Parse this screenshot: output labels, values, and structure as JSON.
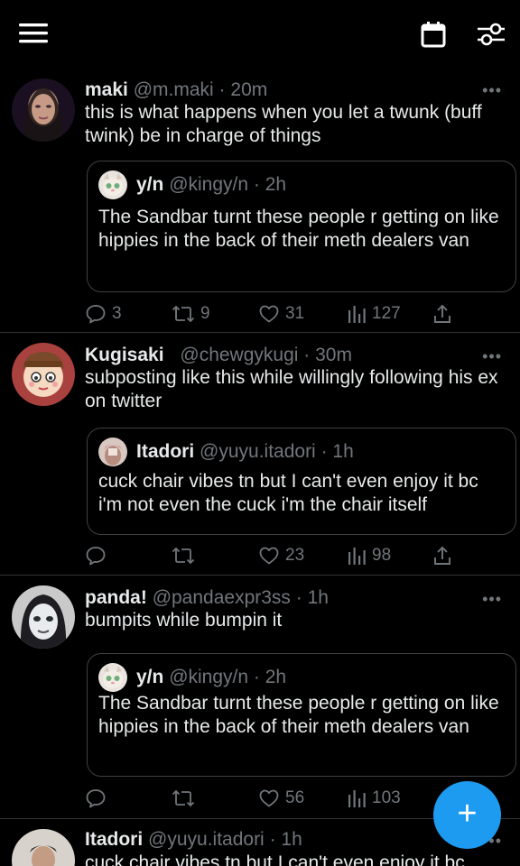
{
  "tweets": [
    {
      "name": "maki",
      "handle": "@m.maki",
      "time": "20m",
      "text": "this is what happens when you let a twunk (buff twink) be in charge of things",
      "quote": {
        "name": "y/n",
        "handle": "@kingy/n",
        "time": "2h",
        "text": "The Sandbar turnt these people r getting on like hippies in the back of their meth dealers van"
      },
      "replies": "3",
      "retweets": "9",
      "likes": "31",
      "views": "127"
    },
    {
      "name": "Kugisaki",
      "handle": "@chewgykugi",
      "time": "30m",
      "text": "subposting like this while willingly following his ex on twitter",
      "quote": {
        "name": "Itadori",
        "handle": "@yuyu.itadori",
        "time": "1h",
        "text": "cuck chair vibes tn but I can't even enjoy it bc i'm not even the cuck i'm the chair itself"
      },
      "replies": "",
      "retweets": "",
      "likes": "23",
      "views": "98"
    },
    {
      "name": "panda!",
      "handle": "@pandaexpr3ss",
      "time": "1h",
      "text": "bumpits while bumpin it",
      "quote": {
        "name": "y/n",
        "handle": "@kingy/n",
        "time": "2h",
        "text": "The Sandbar turnt these people r getting on like hippies in the back of their meth dealers van"
      },
      "replies": "",
      "retweets": "",
      "likes": "56",
      "views": "103"
    },
    {
      "name": "Itadori",
      "handle": "@yuyu.itadori",
      "time": "1h",
      "text": "cuck chair vibes tn but I can't even enjoy it bc"
    }
  ],
  "more_label": "•••",
  "separator": "·",
  "fab_label": "+",
  "colors": {
    "accent": "#1d9bf0",
    "muted": "#71767b",
    "text": "#e7e9ea",
    "divider": "#2f3336"
  }
}
